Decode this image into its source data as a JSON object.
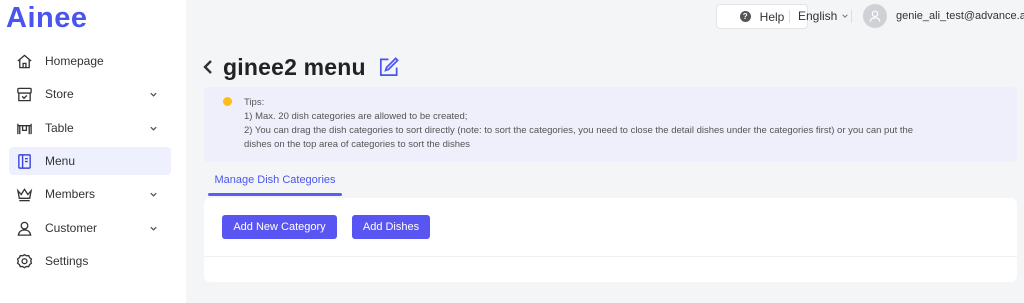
{
  "brand": {
    "logo_text": "Ainee",
    "color": "#4a55f0"
  },
  "sidebar": {
    "items": [
      {
        "label": "Homepage",
        "icon": "home-icon",
        "has_chevron": false,
        "active": false
      },
      {
        "label": "Store",
        "icon": "store-icon",
        "has_chevron": true,
        "active": false
      },
      {
        "label": "Table",
        "icon": "table-icon",
        "has_chevron": true,
        "active": false
      },
      {
        "label": "Menu",
        "icon": "menu-book-icon",
        "has_chevron": false,
        "active": true
      },
      {
        "label": "Members",
        "icon": "crown-icon",
        "has_chevron": true,
        "active": false
      },
      {
        "label": "Customer",
        "icon": "user-icon",
        "has_chevron": true,
        "active": false
      },
      {
        "label": "Settings",
        "icon": "gear-icon",
        "has_chevron": false,
        "active": false
      }
    ]
  },
  "header": {
    "help_label": "Help",
    "language": "English",
    "user_email": "genie_ali_test@advance.ai"
  },
  "page": {
    "title": "ginee2 menu"
  },
  "tips": {
    "heading": "Tips:",
    "line1": "1) Max. 20 dish categories are allowed to be created;",
    "line2": "2) You can drag the dish categories to sort directly (note: to sort the categories, you need to close the detail dishes under the categories first) or you can put the",
    "line3": "dishes on the top area of categories to sort the dishes"
  },
  "tabs": {
    "active_label": "Manage Dish Categories"
  },
  "actions": {
    "add_category_label": "Add New Category",
    "add_dishes_label": "Add Dishes"
  },
  "colors": {
    "accent": "#5955f2",
    "active_bg": "#eef0fd",
    "tips_bg": "#eeeffb",
    "tips_dot": "#fbbd19"
  }
}
